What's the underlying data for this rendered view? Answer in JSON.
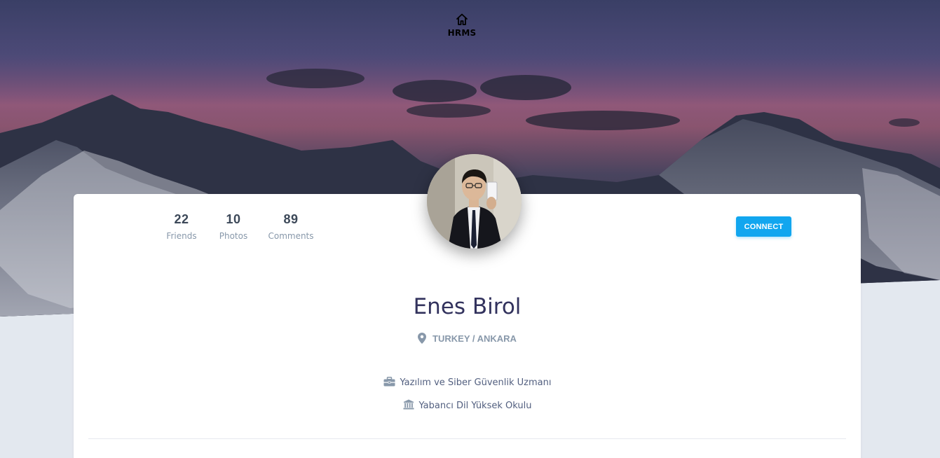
{
  "nav": {
    "brand": "HRMS",
    "home_icon": "home-icon"
  },
  "profile": {
    "name": "Enes Birol",
    "location": "TURKEY / ANKARA",
    "job": "Yazılım ve Siber Güvenlik Uzmanı",
    "school": "Yabancı Dil Yüksek Okulu",
    "avatar_icon": "avatar"
  },
  "stats": [
    {
      "value": "22",
      "label": "Friends"
    },
    {
      "value": "10",
      "label": "Photos"
    },
    {
      "value": "89",
      "label": "Comments"
    }
  ],
  "actions": {
    "connect_label": "CONNECT"
  },
  "colors": {
    "accent": "#11a6ef",
    "name_text": "#32325d",
    "muted_text": "#8898aa",
    "page_bg": "#e3e8ef"
  }
}
